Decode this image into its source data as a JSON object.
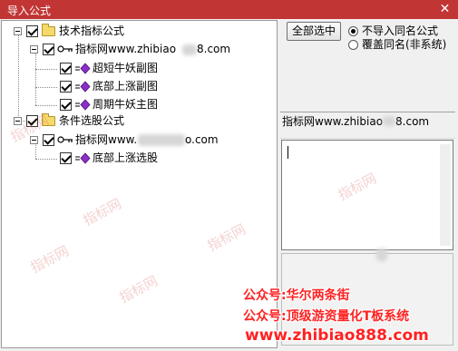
{
  "window": {
    "title": "导入公式",
    "close_glyph": "✕"
  },
  "tree": {
    "root1": {
      "label": "技术指标公式"
    },
    "site1": {
      "label": "指标网www.zhibiao",
      "label_suffix": "8.com"
    },
    "items1": [
      {
        "label": "超短牛妖副图"
      },
      {
        "label": "底部上涨副图"
      },
      {
        "label": "周期牛妖主图"
      }
    ],
    "root2": {
      "label": "条件选股公式"
    },
    "site2": {
      "label": "指标网www.",
      "label_suffix": "o.com"
    },
    "items2": [
      {
        "label": "底部上涨选股"
      }
    ]
  },
  "right": {
    "select_all_button": "全部选中",
    "radio_no_import": "不导入同名公式",
    "radio_overwrite": "覆盖同名(非系统)",
    "radio_selected": "no_import",
    "info_text": "指标网www.zhibiao",
    "info_suffix": "8.com"
  },
  "overlay": {
    "promo_line1": "公众号:华尔两条街",
    "promo_line2": "公众号:顶级游资量化T板系统",
    "promo_line3": "www.zhibiao888.com",
    "watermark": "指标网"
  },
  "colors": {
    "titlebar": "#c23535",
    "promo_red": "#ff2222",
    "formula_icon": "#8b2fc9"
  },
  "icons": {
    "folder": "folder-icon",
    "key": "key-icon",
    "formula": "formula-icon",
    "expander": "collapse-icon",
    "checkbox": "checkbox-checked-icon"
  }
}
